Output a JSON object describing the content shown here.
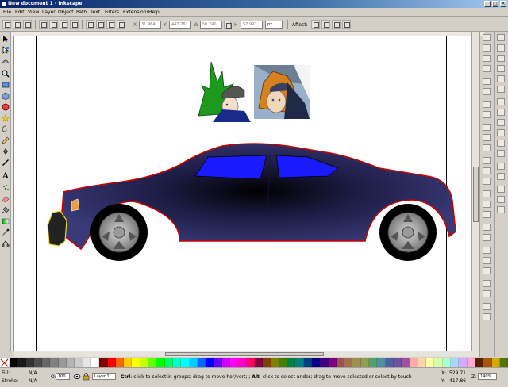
{
  "window": {
    "title": "New document 1 - Inkscape",
    "btn_min": "_",
    "btn_max": "□",
    "btn_close": "×"
  },
  "menu": [
    "File",
    "Edit",
    "View",
    "Layer",
    "Object",
    "Path",
    "Text",
    "Filters",
    "Extensions",
    "Help"
  ],
  "toolbar": {
    "x_label": "X",
    "x_value": "31.964",
    "y_label": "Y",
    "y_value": "447.761",
    "w_label": "W",
    "w_value": "50.740",
    "h_label": "H",
    "h_value": "57.997",
    "unit": "px",
    "affect_label": "Affect:"
  },
  "palette": [
    "#000000",
    "#1a1a1a",
    "#333333",
    "#4d4d4d",
    "#666666",
    "#808080",
    "#999999",
    "#b3b3b3",
    "#cccccc",
    "#e6e6e6",
    "#ffffff",
    "#800000",
    "#ff0000",
    "#ff6600",
    "#ffcc00",
    "#ffff00",
    "#ccff00",
    "#66ff00",
    "#00ff00",
    "#00ff66",
    "#00ffcc",
    "#00ffff",
    "#00ccff",
    "#0066ff",
    "#0000ff",
    "#6600ff",
    "#cc00ff",
    "#ff00ff",
    "#ff00cc",
    "#ff0066",
    "#800040",
    "#804000",
    "#808000",
    "#408000",
    "#008040",
    "#008080",
    "#004080",
    "#000080",
    "#400080",
    "#800080",
    "#a05050",
    "#a07050",
    "#a09050",
    "#90a050",
    "#50a070",
    "#5090a0",
    "#5060a0",
    "#7050a0",
    "#a050a0",
    "#ffaaaa",
    "#ffd5aa",
    "#ffffaa",
    "#d5ffaa",
    "#aaffd5",
    "#aad5ff",
    "#d5aaff",
    "#ffaad5",
    "#552200",
    "#aa5500",
    "#d4aa00",
    "#557700"
  ],
  "status": {
    "fill_label": "Fill:",
    "fill_value": "N/A",
    "stroke_label": "Stroke:",
    "stroke_value": "N/A",
    "opacity_label": "O:",
    "opacity_value": "100",
    "layer_value": "Layer 1",
    "message_bold1": "Ctrl",
    "message1": ": click to select in groups; drag to move hor/vert; ; ",
    "message_bold2": "Alt",
    "message2": ": click to select under; drag to move selected or select by touch",
    "x_label": "X:",
    "x_value": "529.71",
    "y_label": "Y:",
    "y_value": "417.86",
    "z_label": "Z:",
    "zoom_value": "140%"
  },
  "canvas": {
    "car_body_color": "#3a3a78",
    "car_outline_color": "#cc0000",
    "window_color": "#1a1aff"
  }
}
